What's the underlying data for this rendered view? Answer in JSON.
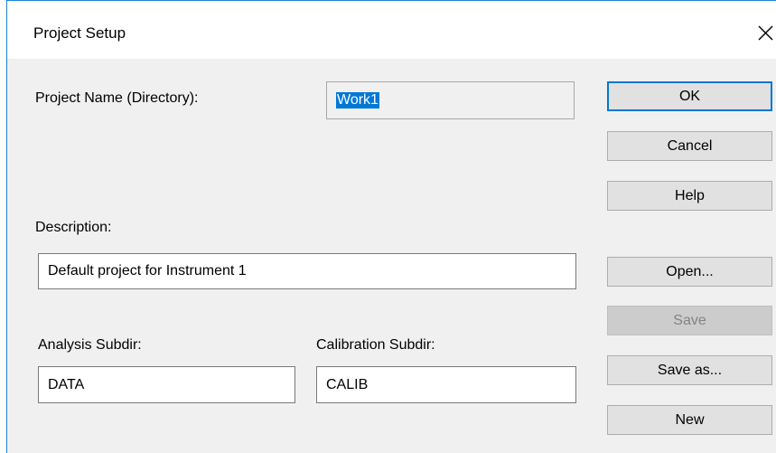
{
  "window": {
    "title": "Project Setup",
    "close_icon": "close-icon"
  },
  "project_name": {
    "label": "Project Name (Directory):",
    "value": "Work1"
  },
  "description": {
    "label": "Description:",
    "value": "Default project for Instrument 1"
  },
  "analysis_subdir": {
    "label": "Analysis Subdir:",
    "value": "DATA"
  },
  "calibration_subdir": {
    "label": "Calibration Subdir:",
    "value": "CALIB"
  },
  "buttons": {
    "ok": "OK",
    "cancel": "Cancel",
    "help": "Help",
    "open": "Open...",
    "save": "Save",
    "save_as": "Save as...",
    "new": "New"
  },
  "colors": {
    "accent": "#0078d7",
    "dialog_background": "#f0f0f0",
    "disabled_text": "#838383"
  }
}
